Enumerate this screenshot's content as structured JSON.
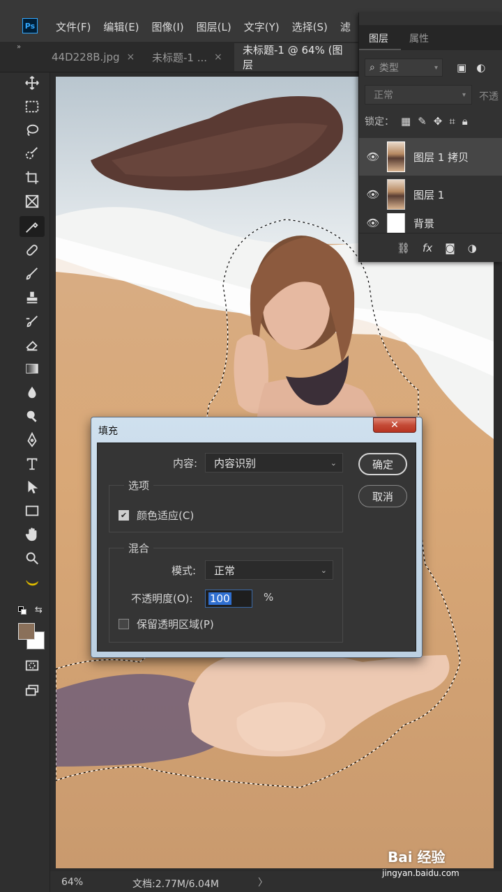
{
  "app": {
    "logo": "Ps"
  },
  "menu": [
    "文件(F)",
    "编辑(E)",
    "图像(I)",
    "图层(L)",
    "文字(Y)",
    "选择(S)",
    "滤"
  ],
  "tabs": [
    {
      "label": "44D228B.jpg",
      "close": "×",
      "active": false
    },
    {
      "label": "未标题-1 ...",
      "close": "×",
      "active": false
    },
    {
      "label": "未标题-1 @ 64% (图层",
      "close": "",
      "active": true
    }
  ],
  "tools": [
    "move-icon",
    "marquee-icon",
    "lasso-icon",
    "quick-select-icon",
    "crop-icon",
    "frame-icon",
    "eyedropper-icon",
    "healing-brush-icon",
    "brush-icon",
    "stamp-icon",
    "history-brush-icon",
    "eraser-icon",
    "gradient-icon",
    "blur-icon",
    "dodge-icon",
    "pen-icon",
    "type-icon",
    "path-select-icon",
    "rectangle-icon",
    "hand-icon",
    "zoom-icon",
    "banana-icon"
  ],
  "colors": {
    "foreground": "#8a705a",
    "background": "#ffffff",
    "accent": "#31a8ff"
  },
  "status": {
    "zoom": "64%",
    "doc": "文档:2.77M/6.04M",
    "arrow": "〉"
  },
  "layers_panel": {
    "tab_layers": "图层",
    "tab_properties": "属性",
    "filter_placeholder": "类型",
    "blend_mode": "正常",
    "opacity_label": "不透",
    "lock_label": "锁定：",
    "layers": [
      {
        "name": "图层 1 拷贝",
        "selected": true
      },
      {
        "name": "图层 1",
        "selected": false
      },
      {
        "name": "背景",
        "selected": false
      }
    ]
  },
  "fill_dialog": {
    "title": "填充",
    "close": "✕",
    "content_label": "内容:",
    "content_value": "内容识别",
    "options_label": "选项",
    "color_adapt_label": "颜色适应(C)",
    "color_adapt_checked": true,
    "blend_label": "混合",
    "mode_label": "模式:",
    "mode_value": "正常",
    "opacity_label": "不透明度(O):",
    "opacity_value": "100",
    "opacity_unit": "%",
    "preserve_label": "保留透明区域(P)",
    "preserve_checked": false,
    "ok_label": "确定",
    "cancel_label": "取消"
  },
  "watermark": {
    "brand": "Bai 经验",
    "url": "jingyan.baidu.com"
  }
}
